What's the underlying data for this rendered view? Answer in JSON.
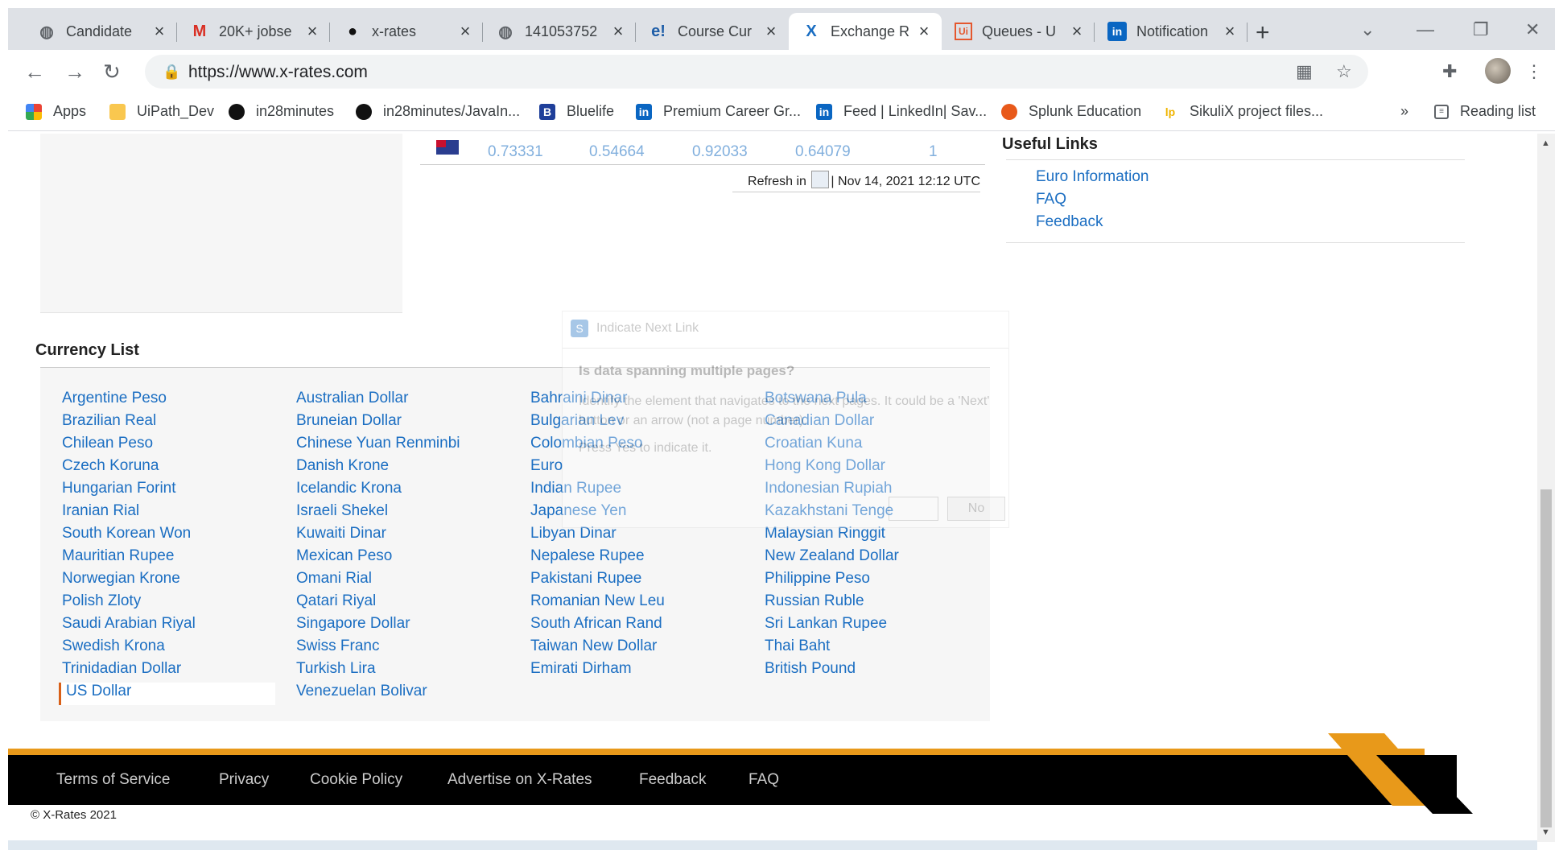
{
  "browser": {
    "tabs": [
      {
        "title": "Candidate",
        "icon": "globe-icon"
      },
      {
        "title": "20K+ jobse",
        "icon": "gmail-icon"
      },
      {
        "title": "x-rates",
        "icon": "github-icon"
      },
      {
        "title": "141053752",
        "icon": "globe-icon"
      },
      {
        "title": "Course Cur",
        "icon": "e-logo-icon"
      },
      {
        "title": "Exchange R",
        "icon": "x-logo-icon",
        "active": true
      },
      {
        "title": "Queues - U",
        "icon": "uipath-icon"
      },
      {
        "title": "Notification",
        "icon": "linkedin-icon"
      }
    ],
    "url": "https://www.x-rates.com",
    "bookmarks": [
      {
        "label": "Apps",
        "icon": "apps-grid-icon"
      },
      {
        "label": "UiPath_Dev",
        "icon": "folder-icon"
      },
      {
        "label": "in28minutes",
        "icon": "github-icon"
      },
      {
        "label": "in28minutes/JavaIn...",
        "icon": "github-icon"
      },
      {
        "label": "Bluelife",
        "icon": "bluelife-icon"
      },
      {
        "label": "Premium Career Gr...",
        "icon": "linkedin-icon"
      },
      {
        "label": "Feed | LinkedIn| Sav...",
        "icon": "linkedin-icon"
      },
      {
        "label": "Splunk Education",
        "icon": "splunk-icon"
      },
      {
        "label": "SikuliX project files...",
        "icon": "lp-icon"
      }
    ],
    "bookmarks_overflow": "»",
    "reading_list": "Reading list"
  },
  "rates_row": {
    "values": [
      "0.73331",
      "0.54664",
      "0.92033",
      "0.64079",
      "1"
    ],
    "refresh_prefix": "Refresh in",
    "refresh_time": "| Nov 14, 2021 12:12 UTC"
  },
  "useful_links": {
    "title": "Useful Links",
    "items": [
      "Euro Information",
      "FAQ",
      "Feedback"
    ]
  },
  "currency_list": {
    "title": "Currency List",
    "columns": [
      [
        "Argentine Peso",
        "Brazilian Real",
        "Chilean Peso",
        "Czech Koruna",
        "Hungarian Forint",
        "Iranian Rial",
        "South Korean Won",
        "Mauritian Rupee",
        "Norwegian Krone",
        "Polish Zloty",
        "Saudi Arabian Riyal",
        "Swedish Krona",
        "Trinidadian Dollar",
        "US Dollar"
      ],
      [
        "Australian Dollar",
        "Bruneian Dollar",
        "Chinese Yuan Renminbi",
        "Danish Krone",
        "Icelandic Krona",
        "Israeli Shekel",
        "Kuwaiti Dinar",
        "Mexican Peso",
        "Omani Rial",
        "Qatari Riyal",
        "Singapore Dollar",
        "Swiss Franc",
        "Turkish Lira",
        "Venezuelan Bolivar"
      ],
      [
        "Bahraini Dinar",
        "Bulgarian Lev",
        "Colombian Peso",
        "Euro",
        "Indian Rupee",
        "Japanese Yen",
        "Libyan Dinar",
        "Nepalese Rupee",
        "Pakistani Rupee",
        "Romanian New Leu",
        "South African Rand",
        "Taiwan New Dollar",
        "Emirati Dirham"
      ],
      [
        "Botswana Pula",
        "Canadian Dollar",
        "Croatian Kuna",
        "Hong Kong Dollar",
        "Indonesian Rupiah",
        "Kazakhstani Tenge",
        "Malaysian Ringgit",
        "New Zealand Dollar",
        "Philippine Peso",
        "Russian Ruble",
        "Sri Lankan Rupee",
        "Thai Baht",
        "British Pound"
      ]
    ],
    "selected": "US Dollar"
  },
  "overlay_dialog": {
    "title": "Indicate Next Link",
    "question": "Is data spanning multiple pages?",
    "body": "Identify the element that navigates to the next pages. It could be a 'Next' button or an arrow (not a page number).",
    "hint": "Press Yes to indicate it.",
    "no_label": "No"
  },
  "footer": {
    "links": [
      "Terms of Service",
      "Privacy",
      "Cookie Policy",
      "Advertise on X-Rates",
      "Feedback",
      "FAQ"
    ],
    "copyright": "© X-Rates 2021"
  },
  "colors": {
    "link": "#1b6ec2",
    "accent": "#e8991a",
    "selected_marker": "#d86018"
  }
}
